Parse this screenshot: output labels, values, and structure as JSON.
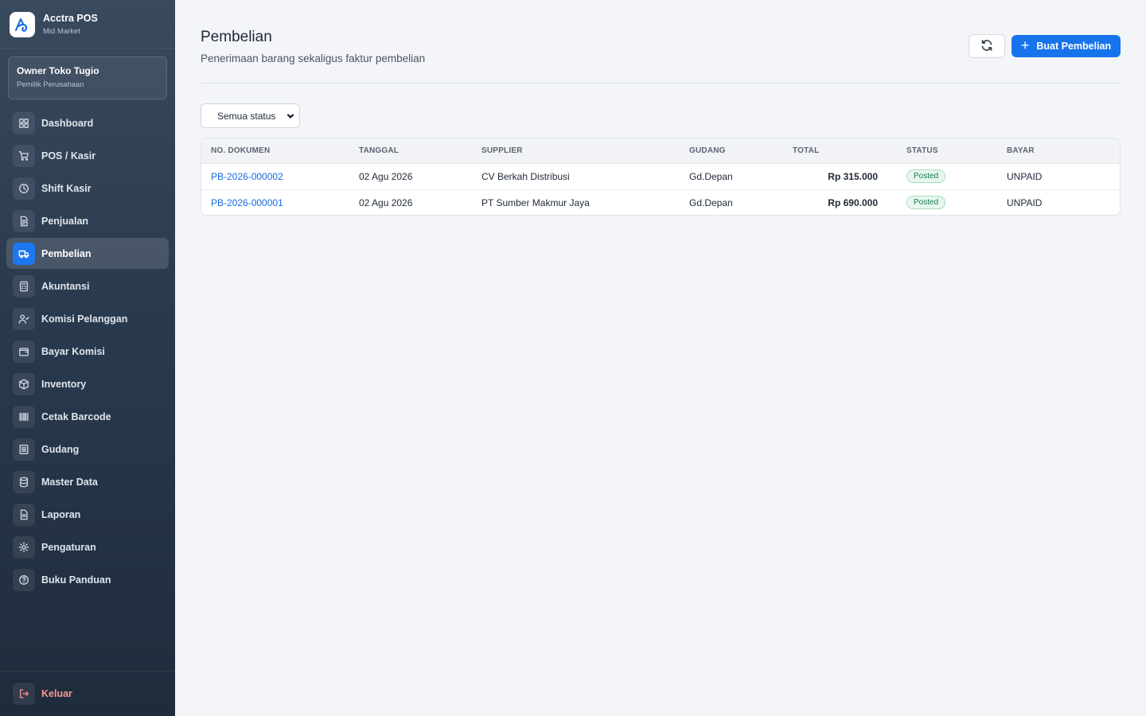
{
  "brand": {
    "name": "Acctra POS",
    "tier": "Mid Market"
  },
  "user": {
    "name": "Owner Toko Tugio",
    "role": "Pemilik Perusahaan"
  },
  "sidebar": {
    "items": [
      {
        "label": "Dashboard",
        "icon": "dashboard-icon"
      },
      {
        "label": "POS / Kasir",
        "icon": "cart-icon"
      },
      {
        "label": "Shift Kasir",
        "icon": "clock-icon"
      },
      {
        "label": "Penjualan",
        "icon": "document-icon"
      },
      {
        "label": "Pembelian",
        "icon": "truck-icon",
        "active": true
      },
      {
        "label": "Akuntansi",
        "icon": "calculator-icon"
      },
      {
        "label": "Komisi Pelanggan",
        "icon": "user-check-icon"
      },
      {
        "label": "Bayar Komisi",
        "icon": "wallet-icon"
      },
      {
        "label": "Inventory",
        "icon": "box-icon"
      },
      {
        "label": "Cetak Barcode",
        "icon": "barcode-icon"
      },
      {
        "label": "Gudang",
        "icon": "warehouse-icon"
      },
      {
        "label": "Master Data",
        "icon": "database-icon"
      },
      {
        "label": "Laporan",
        "icon": "report-icon"
      },
      {
        "label": "Pengaturan",
        "icon": "gear-icon"
      },
      {
        "label": "Buku Panduan",
        "icon": "help-icon"
      }
    ],
    "logout_label": "Keluar"
  },
  "page": {
    "title": "Pembelian",
    "subtitle": "Penerimaan barang sekaligus faktur pembelian",
    "create_button": "Buat Pembelian"
  },
  "filter": {
    "selected": "Semua status"
  },
  "table": {
    "columns": [
      "NO. DOKUMEN",
      "TANGGAL",
      "SUPPLIER",
      "GUDANG",
      "TOTAL",
      "STATUS",
      "BAYAR"
    ],
    "rows": [
      {
        "doc": "PB-2026-000002",
        "date": "02 Agu 2026",
        "supplier": "CV Berkah Distribusi",
        "warehouse": "Gd.Depan",
        "total": "Rp 315.000",
        "status": "Posted",
        "payment": "UNPAID"
      },
      {
        "doc": "PB-2026-000001",
        "date": "02 Agu 2026",
        "supplier": "PT Sumber Makmur Jaya",
        "warehouse": "Gd.Depan",
        "total": "Rp 690.000",
        "status": "Posted",
        "payment": "UNPAID"
      }
    ]
  },
  "colors": {
    "accent": "#1773ec",
    "link": "#1769e0",
    "status_posted": "#177a4a",
    "logout": "#f49a9a"
  }
}
